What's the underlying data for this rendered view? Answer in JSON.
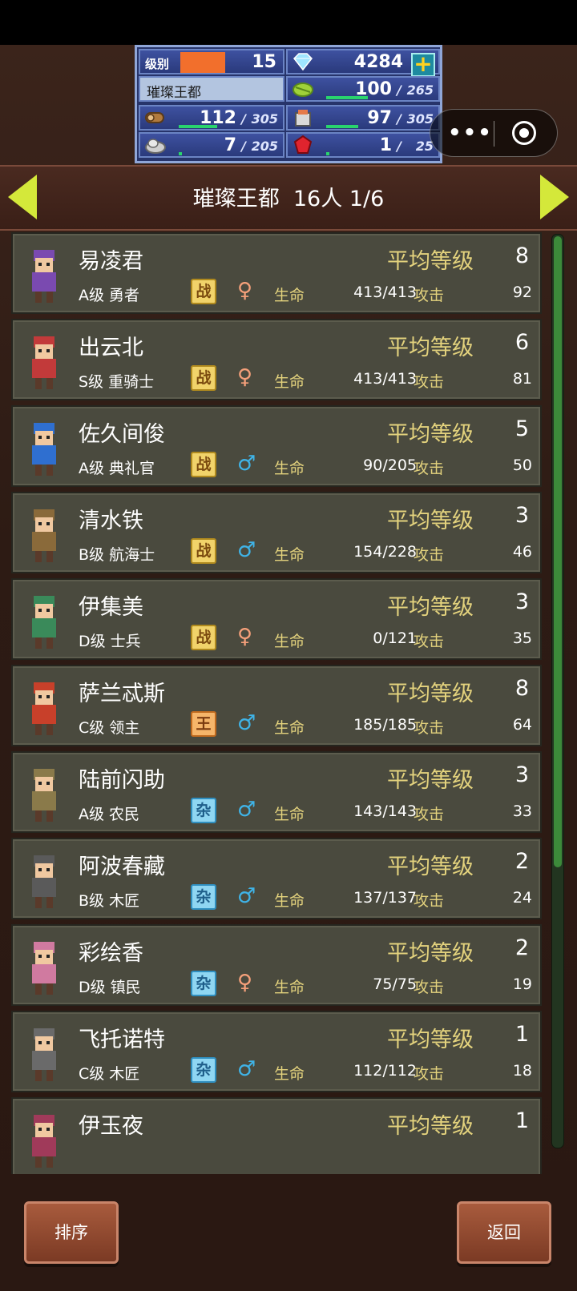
{
  "hud": {
    "level_label": "级别",
    "level": "15",
    "gems": "4284",
    "city": "璀璨王都",
    "food": "100",
    "food_cap": "265",
    "wood": "112",
    "wood_cap": "305",
    "goods": "97",
    "goods_cap": "305",
    "stone": "7",
    "stone_cap": "205",
    "ruby": "1",
    "ruby_cap": "25",
    "bar_fraction": {
      "food": 0.38,
      "wood": 0.37,
      "goods": 0.32,
      "stone": 0.03,
      "ruby": 0.04
    }
  },
  "header": {
    "title": "璀璨王都  16人 1/6"
  },
  "labels": {
    "avg_level": "平均等级",
    "hp": "生命",
    "attack": "攻击"
  },
  "characters": [
    {
      "name": "易凌君",
      "avg_level": "8",
      "class": "A级 勇者",
      "badge": "战",
      "badge_type": "war",
      "gender": "♀",
      "gender_type": "f",
      "hp": "413/413",
      "attack": "92"
    },
    {
      "name": "出云北",
      "avg_level": "6",
      "class": "S级 重骑士",
      "badge": "战",
      "badge_type": "war",
      "gender": "♀",
      "gender_type": "f",
      "hp": "413/413",
      "attack": "81"
    },
    {
      "name": "佐久间俊",
      "avg_level": "5",
      "class": "A级 典礼官",
      "badge": "战",
      "badge_type": "war",
      "gender": "♂",
      "gender_type": "m",
      "hp": "90/205",
      "attack": "50"
    },
    {
      "name": "清水铁",
      "avg_level": "3",
      "class": "B级 航海士",
      "badge": "战",
      "badge_type": "war",
      "gender": "♂",
      "gender_type": "m",
      "hp": "154/228",
      "attack": "46"
    },
    {
      "name": "伊集美",
      "avg_level": "3",
      "class": "D级 士兵",
      "badge": "战",
      "badge_type": "war",
      "gender": "♀",
      "gender_type": "f",
      "hp": "0/121",
      "attack": "35"
    },
    {
      "name": "萨兰忒斯",
      "avg_level": "8",
      "class": "C级 领主",
      "badge": "王",
      "badge_type": "king",
      "gender": "♂",
      "gender_type": "m",
      "hp": "185/185",
      "attack": "64"
    },
    {
      "name": "陆前闪助",
      "avg_level": "3",
      "class": "A级 农民",
      "badge": "杂",
      "badge_type": "misc",
      "gender": "♂",
      "gender_type": "m",
      "hp": "143/143",
      "attack": "33"
    },
    {
      "name": "阿波春藏",
      "avg_level": "2",
      "class": "B级 木匠",
      "badge": "杂",
      "badge_type": "misc",
      "gender": "♂",
      "gender_type": "m",
      "hp": "137/137",
      "attack": "24"
    },
    {
      "name": "彩绘香",
      "avg_level": "2",
      "class": "D级 镇民",
      "badge": "杂",
      "badge_type": "misc",
      "gender": "♀",
      "gender_type": "f",
      "hp": "75/75",
      "attack": "19"
    },
    {
      "name": "飞托诺特",
      "avg_level": "1",
      "class": "C级 木匠",
      "badge": "杂",
      "badge_type": "misc",
      "gender": "♂",
      "gender_type": "m",
      "hp": "112/112",
      "attack": "18"
    },
    {
      "name": "伊玉夜",
      "avg_level": "1",
      "class": "",
      "badge": "",
      "badge_type": "",
      "gender": "",
      "gender_type": "",
      "hp": "",
      "attack": ""
    }
  ],
  "buttons": {
    "sort": "排序",
    "back": "返回"
  },
  "colors": {
    "accent_arrow": "#d4e83a",
    "avg_label": "#e3d27d",
    "card_bg": "#4a4a3e"
  }
}
